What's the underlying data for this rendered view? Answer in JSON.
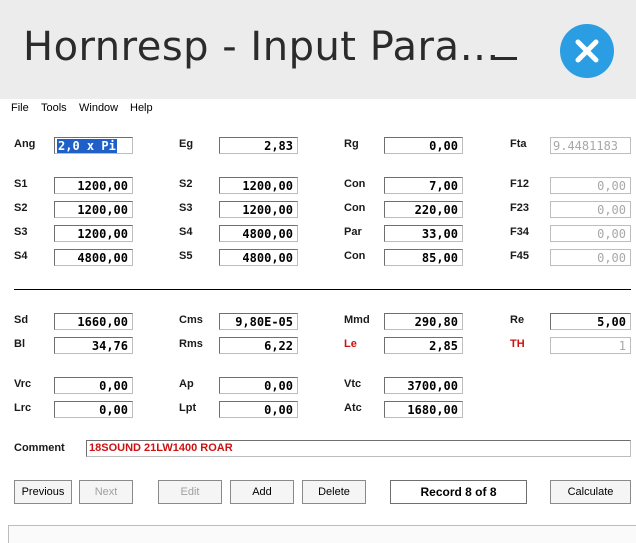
{
  "window": {
    "title": "Hornresp - Input Para…"
  },
  "menu": [
    "File",
    "Tools",
    "Window",
    "Help"
  ],
  "fields": {
    "ang": {
      "label": "Ang",
      "value": "2,0 x Pi"
    },
    "eg": {
      "label": "Eg",
      "value": "2,83"
    },
    "rg": {
      "label": "Rg",
      "value": "0,00"
    },
    "fta": {
      "label": "Fta",
      "value": "9.4481183"
    },
    "s1": {
      "label": "S1",
      "value": "1200,00"
    },
    "s2a": {
      "label": "S2",
      "value": "1200,00"
    },
    "s3a": {
      "label": "S3",
      "value": "1200,00"
    },
    "s4a": {
      "label": "S4",
      "value": "4800,00"
    },
    "s2b": {
      "label": "S2",
      "value": "1200,00"
    },
    "s3b": {
      "label": "S3",
      "value": "1200,00"
    },
    "s4b": {
      "label": "S4",
      "value": "4800,00"
    },
    "s5": {
      "label": "S5",
      "value": "4800,00"
    },
    "con1": {
      "label": "Con",
      "value": "7,00"
    },
    "con2": {
      "label": "Con",
      "value": "220,00"
    },
    "par": {
      "label": "Par",
      "value": "33,00"
    },
    "con3": {
      "label": "Con",
      "value": "85,00"
    },
    "f12": {
      "label": "F12",
      "value": "0,00"
    },
    "f23": {
      "label": "F23",
      "value": "0,00"
    },
    "f34": {
      "label": "F34",
      "value": "0,00"
    },
    "f45": {
      "label": "F45",
      "value": "0,00"
    },
    "sd": {
      "label": "Sd",
      "value": "1660,00"
    },
    "bl": {
      "label": "Bl",
      "value": "34,76"
    },
    "cms": {
      "label": "Cms",
      "value": "9,80E-05"
    },
    "rms": {
      "label": "Rms",
      "value": "6,22"
    },
    "mmd": {
      "label": "Mmd",
      "value": "290,80"
    },
    "le": {
      "label": "Le",
      "value": "2,85"
    },
    "re": {
      "label": "Re",
      "value": "5,00"
    },
    "th": {
      "label": "TH",
      "value": "1"
    },
    "vrc": {
      "label": "Vrc",
      "value": "0,00"
    },
    "lrc": {
      "label": "Lrc",
      "value": "0,00"
    },
    "ap": {
      "label": "Ap",
      "value": "0,00"
    },
    "lpt": {
      "label": "Lpt",
      "value": "0,00"
    },
    "vtc": {
      "label": "Vtc",
      "value": "3700,00"
    },
    "atc": {
      "label": "Atc",
      "value": "1680,00"
    }
  },
  "comment": {
    "label": "Comment",
    "value": "18SOUND 21LW1400 ROAR"
  },
  "buttons": {
    "previous": "Previous",
    "next": "Next",
    "edit": "Edit",
    "add": "Add",
    "delete": "Delete",
    "calculate": "Calculate"
  },
  "record": "Record 8 of 8",
  "colors": {
    "accent": "#2b9de3",
    "warning_label": "#cc1111",
    "selection": "#1f5fc8"
  }
}
